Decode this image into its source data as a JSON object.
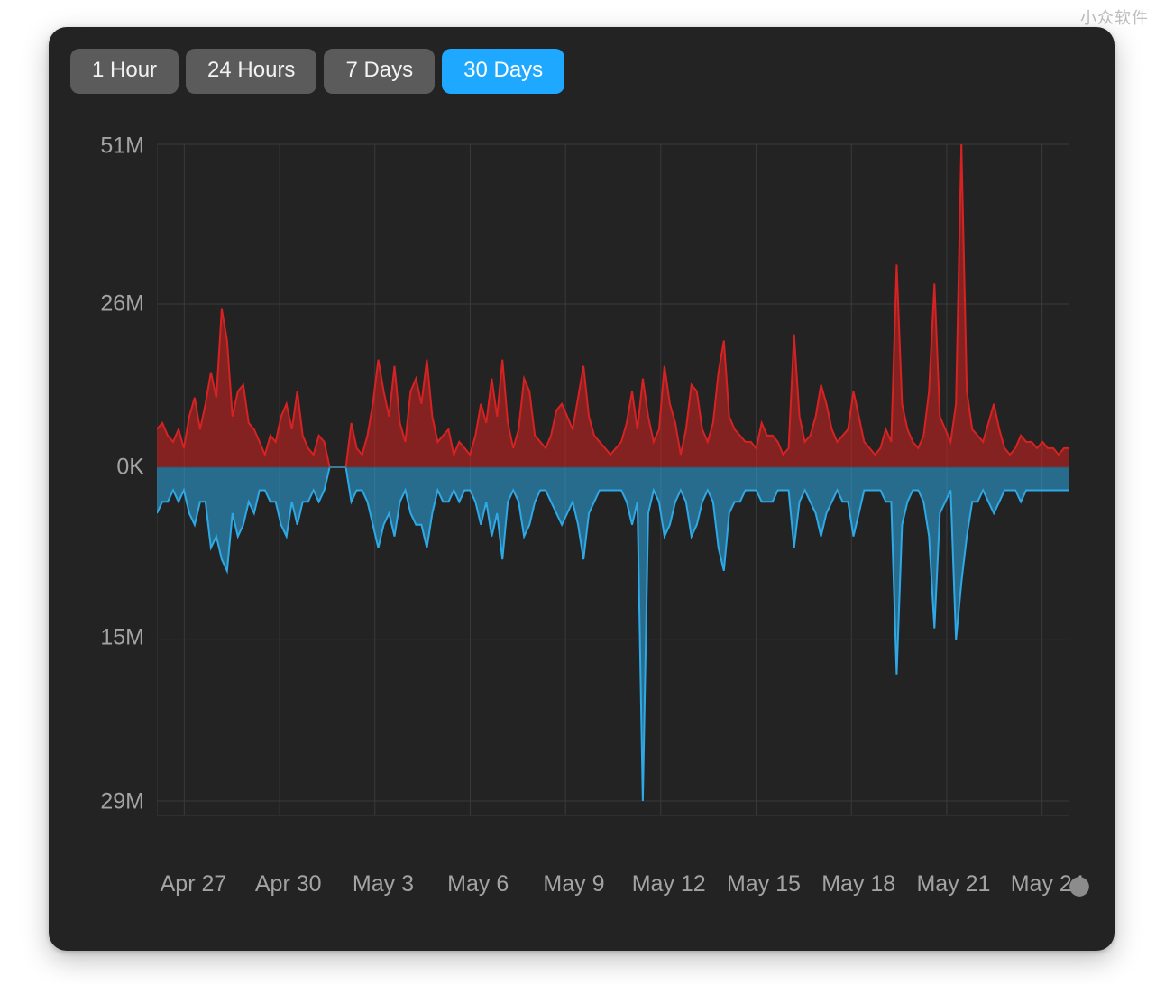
{
  "watermark": "小众软件",
  "tabs": [
    {
      "label": "1 Hour",
      "active": false
    },
    {
      "label": "24 Hours",
      "active": false
    },
    {
      "label": "7 Days",
      "active": false
    },
    {
      "label": "30 Days",
      "active": true
    }
  ],
  "chart_data": {
    "type": "area",
    "title": "",
    "xlabel": "",
    "ylabel": "",
    "y_top_max": 51,
    "y_bottom_max": 29,
    "y_tick_labels_top": [
      "51M",
      "26M",
      "0K"
    ],
    "y_tick_values_top": [
      51,
      26,
      0
    ],
    "y_tick_labels_bottom": [
      "15M",
      "29M"
    ],
    "y_tick_values_bottom": [
      15,
      29
    ],
    "x_categories": [
      "Apr 27",
      "Apr 30",
      "May 3",
      "May 6",
      "May 9",
      "May 12",
      "May 15",
      "May 18",
      "May 21",
      "May 24"
    ],
    "colors": {
      "up": "#d62222",
      "down": "#2ea9e6"
    },
    "series": [
      {
        "name": "up",
        "values": [
          6,
          7,
          5,
          4,
          6,
          3,
          8,
          11,
          6,
          10,
          15,
          11,
          25,
          20,
          8,
          12,
          13,
          7,
          6,
          4,
          2,
          5,
          4,
          8,
          10,
          6,
          12,
          5,
          3,
          2,
          5,
          4,
          0,
          0,
          0,
          0,
          7,
          3,
          2,
          5,
          10,
          17,
          12,
          8,
          16,
          7,
          4,
          12,
          14,
          10,
          17,
          8,
          4,
          5,
          6,
          2,
          4,
          3,
          2,
          5,
          10,
          7,
          14,
          8,
          17,
          7,
          3,
          6,
          14,
          12,
          5,
          4,
          3,
          5,
          9,
          10,
          8,
          6,
          11,
          16,
          8,
          5,
          4,
          3,
          2,
          3,
          4,
          7,
          12,
          6,
          14,
          8,
          4,
          6,
          16,
          10,
          7,
          2,
          6,
          13,
          12,
          6,
          4,
          7,
          15,
          20,
          8,
          6,
          5,
          4,
          4,
          3,
          7,
          5,
          5,
          4,
          2,
          3,
          21,
          8,
          4,
          5,
          8,
          13,
          10,
          6,
          4,
          5,
          6,
          12,
          8,
          4,
          3,
          2,
          3,
          6,
          4,
          32,
          10,
          6,
          4,
          3,
          5,
          12,
          29,
          8,
          6,
          4,
          10,
          51,
          12,
          6,
          5,
          4,
          7,
          10,
          6,
          3,
          2,
          3,
          5,
          4,
          4,
          3,
          4,
          3,
          3,
          2,
          3,
          3
        ]
      },
      {
        "name": "down",
        "values": [
          4,
          3,
          3,
          2,
          3,
          2,
          4,
          5,
          3,
          3,
          7,
          6,
          8,
          9,
          4,
          6,
          5,
          3,
          4,
          2,
          2,
          3,
          3,
          5,
          6,
          3,
          5,
          3,
          3,
          2,
          3,
          2,
          0,
          0,
          0,
          0,
          3,
          2,
          2,
          3,
          5,
          7,
          5,
          4,
          6,
          3,
          2,
          4,
          5,
          5,
          7,
          4,
          2,
          3,
          3,
          2,
          3,
          2,
          2,
          3,
          5,
          3,
          6,
          4,
          8,
          3,
          2,
          3,
          6,
          5,
          3,
          2,
          2,
          3,
          4,
          5,
          4,
          3,
          5,
          8,
          4,
          3,
          2,
          2,
          2,
          2,
          2,
          3,
          5,
          3,
          29,
          4,
          2,
          3,
          6,
          5,
          3,
          2,
          3,
          6,
          5,
          3,
          2,
          3,
          7,
          9,
          4,
          3,
          3,
          2,
          2,
          2,
          3,
          3,
          3,
          2,
          2,
          2,
          7,
          3,
          2,
          3,
          4,
          6,
          4,
          3,
          2,
          3,
          3,
          6,
          4,
          2,
          2,
          2,
          2,
          3,
          3,
          18,
          5,
          3,
          2,
          2,
          3,
          6,
          14,
          4,
          3,
          2,
          15,
          10,
          6,
          3,
          3,
          2,
          3,
          4,
          3,
          2,
          2,
          2,
          3,
          2,
          2,
          2,
          2,
          2,
          2,
          2,
          2,
          2
        ]
      }
    ]
  }
}
